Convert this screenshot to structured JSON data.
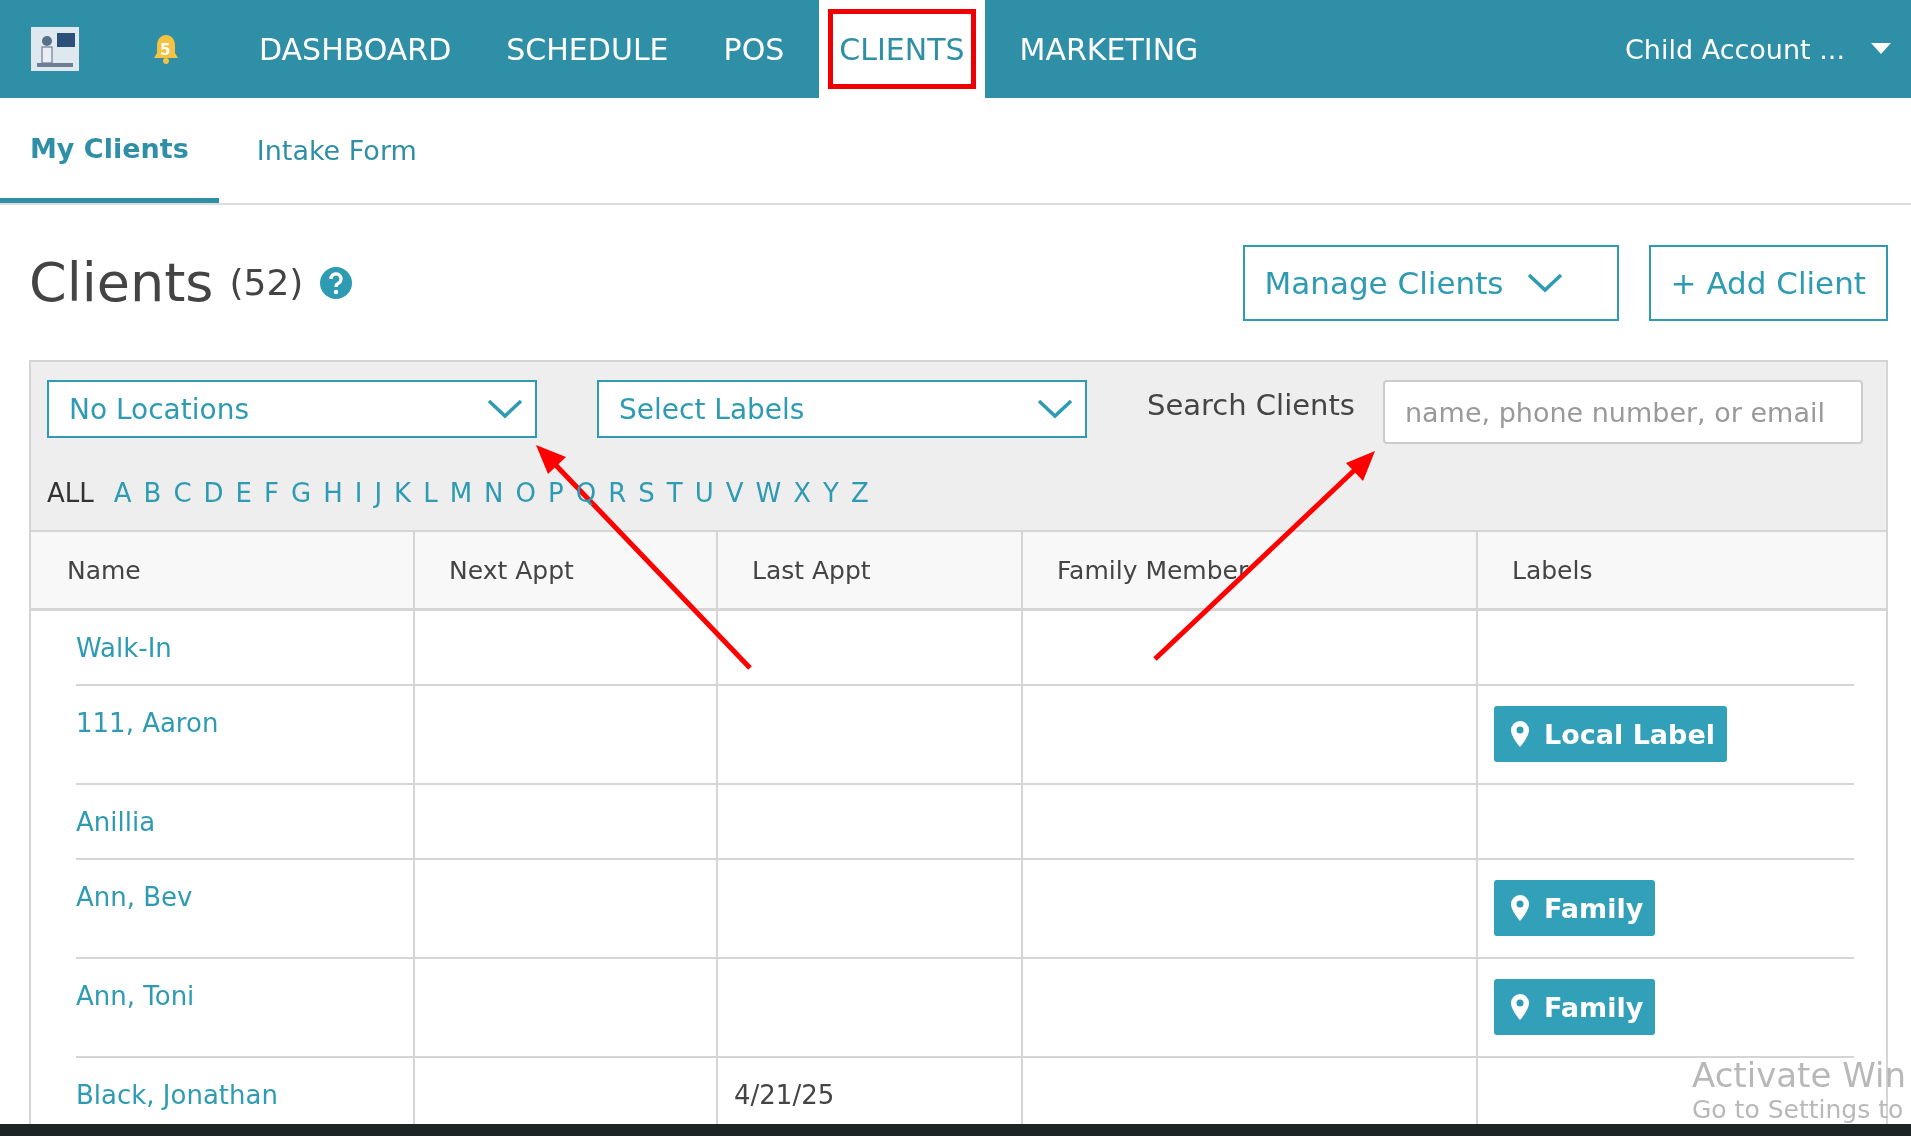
{
  "top_nav": {
    "notification_count": "5",
    "items": [
      {
        "label": "DASHBOARD",
        "selected": false,
        "annotated": false
      },
      {
        "label": "SCHEDULE",
        "selected": false,
        "annotated": false
      },
      {
        "label": "POS",
        "selected": false,
        "annotated": false
      },
      {
        "label": "CLIENTS",
        "selected": true,
        "annotated": true
      },
      {
        "label": "MARKETING",
        "selected": false,
        "annotated": false
      }
    ],
    "account": "Child Account ..."
  },
  "sub_tabs": [
    {
      "label": "My Clients",
      "selected": true
    },
    {
      "label": "Intake Form",
      "selected": false
    }
  ],
  "page_title": {
    "title": "Clients",
    "count": "(52)"
  },
  "actions": {
    "manage": "Manage Clients",
    "add": "+ Add Client"
  },
  "filters": {
    "location": "No Locations",
    "labels": "Select Labels",
    "search_label": "Search Clients",
    "search_placeholder": "name, phone number, or email"
  },
  "letters": [
    {
      "label": "ALL",
      "selected": true
    },
    {
      "label": "A",
      "selected": false
    },
    {
      "label": "B",
      "selected": false
    },
    {
      "label": "C",
      "selected": false
    },
    {
      "label": "D",
      "selected": false
    },
    {
      "label": "E",
      "selected": false
    },
    {
      "label": "F",
      "selected": false
    },
    {
      "label": "G",
      "selected": false
    },
    {
      "label": "H",
      "selected": false
    },
    {
      "label": "I",
      "selected": false
    },
    {
      "label": "J",
      "selected": false
    },
    {
      "label": "K",
      "selected": false
    },
    {
      "label": "L",
      "selected": false
    },
    {
      "label": "M",
      "selected": false
    },
    {
      "label": "N",
      "selected": false
    },
    {
      "label": "O",
      "selected": false
    },
    {
      "label": "P",
      "selected": false
    },
    {
      "label": "Q",
      "selected": false
    },
    {
      "label": "R",
      "selected": false
    },
    {
      "label": "S",
      "selected": false
    },
    {
      "label": "T",
      "selected": false
    },
    {
      "label": "U",
      "selected": false
    },
    {
      "label": "V",
      "selected": false
    },
    {
      "label": "W",
      "selected": false
    },
    {
      "label": "X",
      "selected": false
    },
    {
      "label": "Y",
      "selected": false
    },
    {
      "label": "Z",
      "selected": false
    }
  ],
  "table": {
    "columns": [
      "Name",
      "Next Appt",
      "Last Appt",
      "Family Member",
      "Labels"
    ],
    "rows": [
      {
        "name": "Walk-In"
      },
      {
        "name": "111, Aaron",
        "labels": [
          "Local Label"
        ]
      },
      {
        "name": "Anillia"
      },
      {
        "name": "Ann, Bev",
        "labels": [
          "Family"
        ]
      },
      {
        "name": "Ann, Toni",
        "labels": [
          "Family"
        ]
      },
      {
        "name": "Black, Jonathan",
        "last_appt": "4/21/25"
      }
    ]
  },
  "os_overlay": {
    "line_1": "Activate Win",
    "line_2": "Go to Settings to"
  }
}
